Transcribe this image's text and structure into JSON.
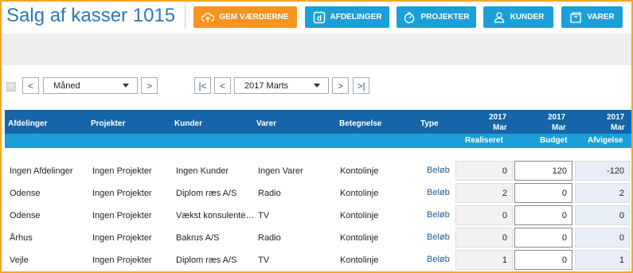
{
  "header": {
    "title": "Salg af kasser 1015",
    "buttons": {
      "save": "GEM VÆRDIERNE",
      "departments": "AFDELINGER",
      "projects": "PROJEKTER",
      "customers": "KUNDER",
      "products": "VARER"
    }
  },
  "toolbar": {
    "expand": "+",
    "period_type": "Måned",
    "period": "2017 Marts",
    "prev": "<",
    "next": ">",
    "first": "|<",
    "last": ">|"
  },
  "table": {
    "headers": {
      "afdelinger": "Afdelinger",
      "projekter": "Projekter",
      "kunder": "Kunder",
      "varer": "Varer",
      "betegnelse": "Betegnelse",
      "type": "Type",
      "col1_year": "2017",
      "col1_month": "Mar",
      "col2_year": "2017",
      "col2_month": "Mar",
      "col3_year": "2017",
      "col3_month": "Mar",
      "realiseret": "Realiseret",
      "budget": "Budget",
      "afvigelse": "Afvigelse"
    },
    "rows": [
      {
        "afdeling": "Ingen Afdelinger",
        "projekt": "Ingen Projekter",
        "kunde": "Ingen Kunder",
        "vare": "Ingen Varer",
        "betegnelse": "Kontolinje",
        "type": "Beløb",
        "realiseret": "0",
        "budget": "120",
        "afvigelse": "-120"
      },
      {
        "afdeling": "Odense",
        "projekt": "Ingen Projekter",
        "kunde": "Diplom ræs A/S",
        "vare": "Radio",
        "betegnelse": "Kontolinje",
        "type": "Beløb",
        "realiseret": "2",
        "budget": "0",
        "afvigelse": "2"
      },
      {
        "afdeling": "Odense",
        "projekt": "Ingen Projekter",
        "kunde": "Vækst konsulente…",
        "vare": "TV",
        "betegnelse": "Kontolinje",
        "type": "Beløb",
        "realiseret": "0",
        "budget": "0",
        "afvigelse": "0"
      },
      {
        "afdeling": "Århus",
        "projekt": "Ingen Projekter",
        "kunde": "Bakrus A/S",
        "vare": "Radio",
        "betegnelse": "Kontolinje",
        "type": "Beløb",
        "realiseret": "0",
        "budget": "0",
        "afvigelse": "0"
      },
      {
        "afdeling": "Vejle",
        "projekt": "Ingen Projekter",
        "kunde": "Diplom ræs A/S",
        "vare": "TV",
        "betegnelse": "Kontolinje",
        "type": "Beløb",
        "realiseret": "1",
        "budget": "0",
        "afvigelse": "1"
      }
    ]
  },
  "icons": {
    "save": "cloud-upload-icon",
    "departments": "department-d-icon",
    "projects": "stopwatch-icon",
    "customers": "users-icon",
    "products": "box-icon"
  },
  "colors": {
    "title": "#2a7ab8",
    "save_button": "#f7941d",
    "nav_button": "#1aa0d8",
    "header_dark": "#1565a8",
    "header_light": "#1aa0d8",
    "frame_border": "#f5a623"
  }
}
